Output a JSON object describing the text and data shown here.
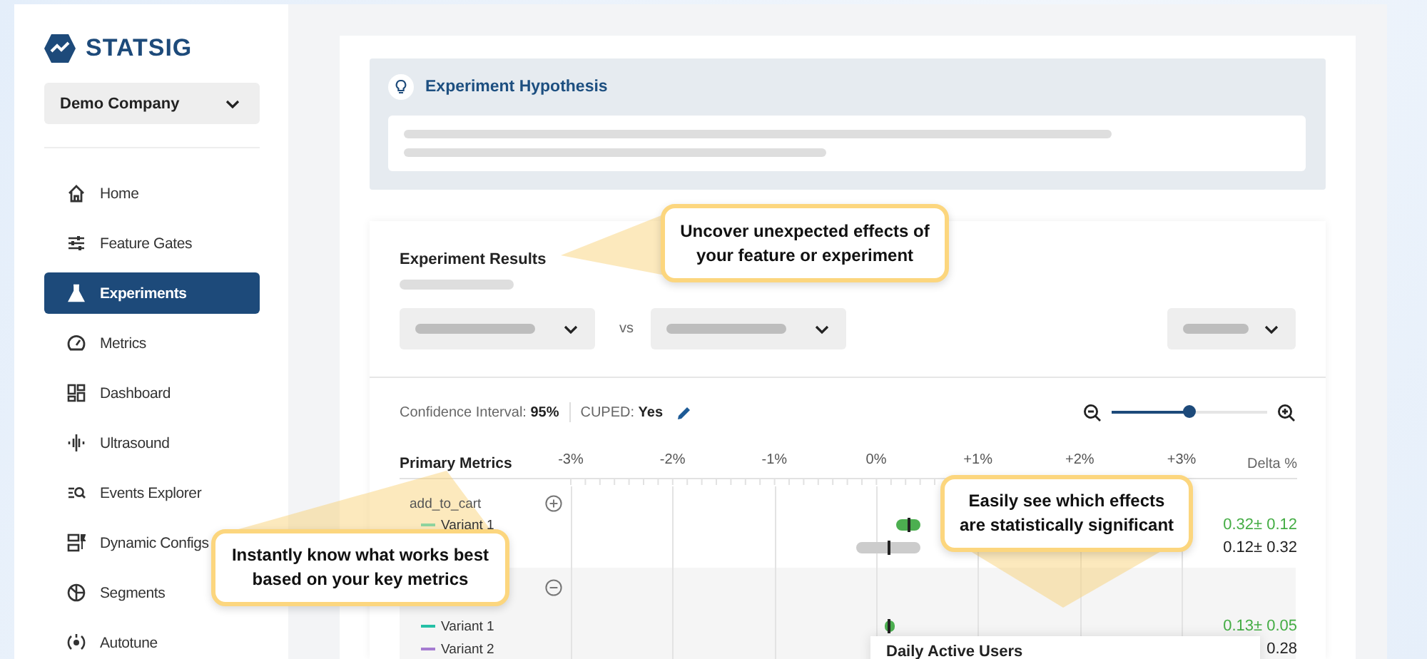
{
  "sidebar": {
    "logo": "STATSIG",
    "org_selector": {
      "value": "Demo Company"
    },
    "items": [
      {
        "label": "Home",
        "selected": false
      },
      {
        "label": "Feature Gates",
        "selected": false
      },
      {
        "label": "Experiments",
        "selected": true
      },
      {
        "label": "Metrics",
        "selected": false
      },
      {
        "label": "Dashboard",
        "selected": false
      },
      {
        "label": "Ultrasound",
        "selected": false
      },
      {
        "label": "Events Explorer",
        "selected": false
      },
      {
        "label": "Dynamic Configs",
        "selected": false
      },
      {
        "label": "Segments",
        "selected": false
      },
      {
        "label": "Autotune",
        "selected": false
      }
    ]
  },
  "hypothesis": {
    "title": "Experiment Hypothesis"
  },
  "results": {
    "title": "Experiment Results",
    "vs_label": "vs",
    "confidence": "Confidence Interval: **95%**",
    "cuped": "CUPED: **Yes**",
    "zoom": {
      "level": 0.5
    },
    "metrics_table": {
      "metric_header": "Primary Metrics",
      "axis_labels": [
        "-3%",
        "-2%",
        "-1%",
        "0%",
        "+1%",
        "+2%",
        "+3%"
      ],
      "delta_header": "Delta %",
      "rows": [
        {
          "metric": "add_to_cart",
          "expanded": false,
          "variants": [
            {
              "name": "Variant 1",
              "color": "#8fd49f",
              "delta": "0.32± 0.12",
              "significant": true
            },
            {
              "delta": "0.12± 0.32",
              "significant": false
            }
          ]
        },
        {
          "expanded": true,
          "variants": [
            {
              "name": "Variant 1",
              "color": "#26c0a6",
              "delta": "0.13± 0.05",
              "significant": true
            },
            {
              "name": "Variant 2",
              "color": "#a57bd1",
              "delta": "0.28",
              "significant": false
            }
          ]
        }
      ]
    },
    "tooltip": {
      "title": "Daily Active Users"
    }
  },
  "callouts": [
    {
      "text": "Uncover unexpected effects of your feature or experiment"
    },
    {
      "text": "Instantly know what works best based on your key metrics"
    },
    {
      "text": "Easily see which effects are statistically significant"
    }
  ]
}
